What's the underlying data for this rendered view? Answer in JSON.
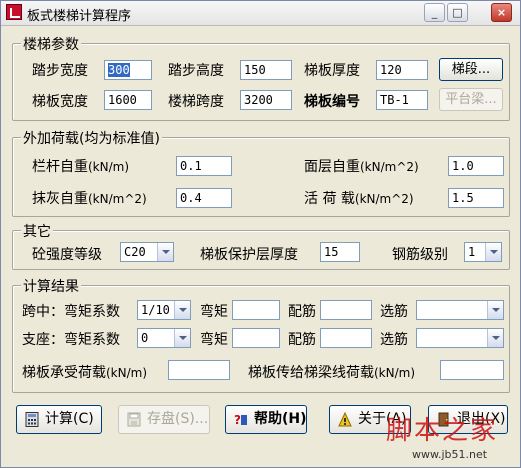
{
  "window": {
    "title": "板式楼梯计算程序"
  },
  "stair_params": {
    "title": "楼梯参数",
    "tread_width": {
      "label": "踏步宽度",
      "value": "300"
    },
    "step_height": {
      "label": "踏步高度",
      "value": "150"
    },
    "slab_thickness": {
      "label": "梯板厚度",
      "value": "120"
    },
    "segment_button": "梯段...",
    "slab_width": {
      "label": "梯板宽度",
      "value": "1600"
    },
    "stair_span": {
      "label": "楼梯跨度",
      "value": "3200"
    },
    "slab_code": {
      "label": "梯板编号",
      "value": "TB-1"
    },
    "landing_button": "平台梁..."
  },
  "extra_loads": {
    "title": "外加荷载(均为标准值)",
    "railing": {
      "label": "栏杆自重",
      "unit": "(kN/m)",
      "value": "0.1"
    },
    "surface": {
      "label": "面层自重",
      "unit": "(kN/m^2)",
      "value": "1.0"
    },
    "plaster": {
      "label": "抹灰自重",
      "unit": "(kN/m^2)",
      "value": "0.4"
    },
    "live": {
      "label": "活 荷 载",
      "unit": "(kN/m^2)",
      "value": "1.5"
    }
  },
  "other": {
    "title": "其它",
    "concrete_label": "砼强度等级",
    "concrete_value": "C20",
    "cover_label": "梯板保护层厚度",
    "cover_value": "15",
    "rebar_label": "钢筋级别",
    "rebar_value": "1"
  },
  "results": {
    "title": "计算结果",
    "mid": {
      "label": "跨中：弯矩系数",
      "coef": "1/10"
    },
    "support": {
      "label": "支座：弯矩系数",
      "coef": "0"
    },
    "moment_label": "弯矩",
    "reinf_label": "配筋",
    "select_label": "选筋",
    "slab_load_label": "梯板承受荷载",
    "slab_load_unit": "(kN/m)",
    "beam_load_label": "梯板传给梯梁线荷载",
    "beam_load_unit": "(kN/m)"
  },
  "buttons": {
    "calc": "计算(C)",
    "save": "存盘(S)...",
    "help": "帮助(H)",
    "about": "关于(A)",
    "exit": "退出(X)"
  },
  "watermark": {
    "text": "脚本之家",
    "url": "www.jb51.net"
  }
}
